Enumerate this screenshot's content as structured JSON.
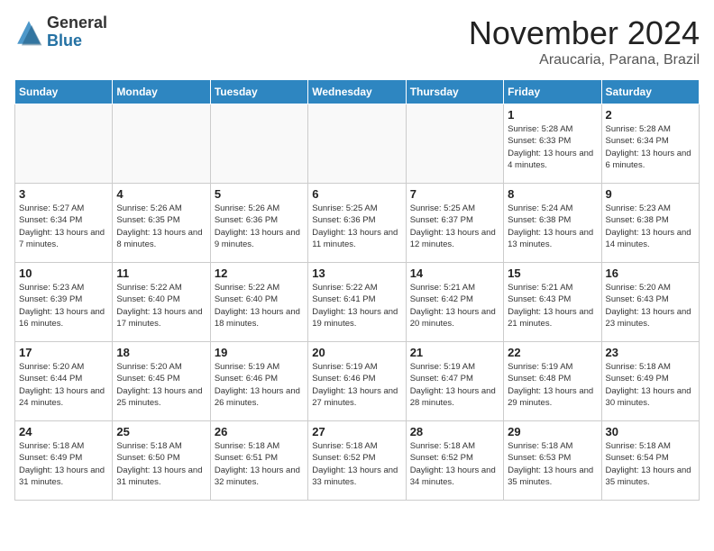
{
  "header": {
    "logo_general": "General",
    "logo_blue": "Blue",
    "month_title": "November 2024",
    "location": "Araucaria, Parana, Brazil"
  },
  "days_of_week": [
    "Sunday",
    "Monday",
    "Tuesday",
    "Wednesday",
    "Thursday",
    "Friday",
    "Saturday"
  ],
  "weeks": [
    [
      {
        "day": "",
        "info": ""
      },
      {
        "day": "",
        "info": ""
      },
      {
        "day": "",
        "info": ""
      },
      {
        "day": "",
        "info": ""
      },
      {
        "day": "",
        "info": ""
      },
      {
        "day": "1",
        "info": "Sunrise: 5:28 AM\nSunset: 6:33 PM\nDaylight: 13 hours and 4 minutes."
      },
      {
        "day": "2",
        "info": "Sunrise: 5:28 AM\nSunset: 6:34 PM\nDaylight: 13 hours and 6 minutes."
      }
    ],
    [
      {
        "day": "3",
        "info": "Sunrise: 5:27 AM\nSunset: 6:34 PM\nDaylight: 13 hours and 7 minutes."
      },
      {
        "day": "4",
        "info": "Sunrise: 5:26 AM\nSunset: 6:35 PM\nDaylight: 13 hours and 8 minutes."
      },
      {
        "day": "5",
        "info": "Sunrise: 5:26 AM\nSunset: 6:36 PM\nDaylight: 13 hours and 9 minutes."
      },
      {
        "day": "6",
        "info": "Sunrise: 5:25 AM\nSunset: 6:36 PM\nDaylight: 13 hours and 11 minutes."
      },
      {
        "day": "7",
        "info": "Sunrise: 5:25 AM\nSunset: 6:37 PM\nDaylight: 13 hours and 12 minutes."
      },
      {
        "day": "8",
        "info": "Sunrise: 5:24 AM\nSunset: 6:38 PM\nDaylight: 13 hours and 13 minutes."
      },
      {
        "day": "9",
        "info": "Sunrise: 5:23 AM\nSunset: 6:38 PM\nDaylight: 13 hours and 14 minutes."
      }
    ],
    [
      {
        "day": "10",
        "info": "Sunrise: 5:23 AM\nSunset: 6:39 PM\nDaylight: 13 hours and 16 minutes."
      },
      {
        "day": "11",
        "info": "Sunrise: 5:22 AM\nSunset: 6:40 PM\nDaylight: 13 hours and 17 minutes."
      },
      {
        "day": "12",
        "info": "Sunrise: 5:22 AM\nSunset: 6:40 PM\nDaylight: 13 hours and 18 minutes."
      },
      {
        "day": "13",
        "info": "Sunrise: 5:22 AM\nSunset: 6:41 PM\nDaylight: 13 hours and 19 minutes."
      },
      {
        "day": "14",
        "info": "Sunrise: 5:21 AM\nSunset: 6:42 PM\nDaylight: 13 hours and 20 minutes."
      },
      {
        "day": "15",
        "info": "Sunrise: 5:21 AM\nSunset: 6:43 PM\nDaylight: 13 hours and 21 minutes."
      },
      {
        "day": "16",
        "info": "Sunrise: 5:20 AM\nSunset: 6:43 PM\nDaylight: 13 hours and 23 minutes."
      }
    ],
    [
      {
        "day": "17",
        "info": "Sunrise: 5:20 AM\nSunset: 6:44 PM\nDaylight: 13 hours and 24 minutes."
      },
      {
        "day": "18",
        "info": "Sunrise: 5:20 AM\nSunset: 6:45 PM\nDaylight: 13 hours and 25 minutes."
      },
      {
        "day": "19",
        "info": "Sunrise: 5:19 AM\nSunset: 6:46 PM\nDaylight: 13 hours and 26 minutes."
      },
      {
        "day": "20",
        "info": "Sunrise: 5:19 AM\nSunset: 6:46 PM\nDaylight: 13 hours and 27 minutes."
      },
      {
        "day": "21",
        "info": "Sunrise: 5:19 AM\nSunset: 6:47 PM\nDaylight: 13 hours and 28 minutes."
      },
      {
        "day": "22",
        "info": "Sunrise: 5:19 AM\nSunset: 6:48 PM\nDaylight: 13 hours and 29 minutes."
      },
      {
        "day": "23",
        "info": "Sunrise: 5:18 AM\nSunset: 6:49 PM\nDaylight: 13 hours and 30 minutes."
      }
    ],
    [
      {
        "day": "24",
        "info": "Sunrise: 5:18 AM\nSunset: 6:49 PM\nDaylight: 13 hours and 31 minutes."
      },
      {
        "day": "25",
        "info": "Sunrise: 5:18 AM\nSunset: 6:50 PM\nDaylight: 13 hours and 31 minutes."
      },
      {
        "day": "26",
        "info": "Sunrise: 5:18 AM\nSunset: 6:51 PM\nDaylight: 13 hours and 32 minutes."
      },
      {
        "day": "27",
        "info": "Sunrise: 5:18 AM\nSunset: 6:52 PM\nDaylight: 13 hours and 33 minutes."
      },
      {
        "day": "28",
        "info": "Sunrise: 5:18 AM\nSunset: 6:52 PM\nDaylight: 13 hours and 34 minutes."
      },
      {
        "day": "29",
        "info": "Sunrise: 5:18 AM\nSunset: 6:53 PM\nDaylight: 13 hours and 35 minutes."
      },
      {
        "day": "30",
        "info": "Sunrise: 5:18 AM\nSunset: 6:54 PM\nDaylight: 13 hours and 35 minutes."
      }
    ]
  ]
}
